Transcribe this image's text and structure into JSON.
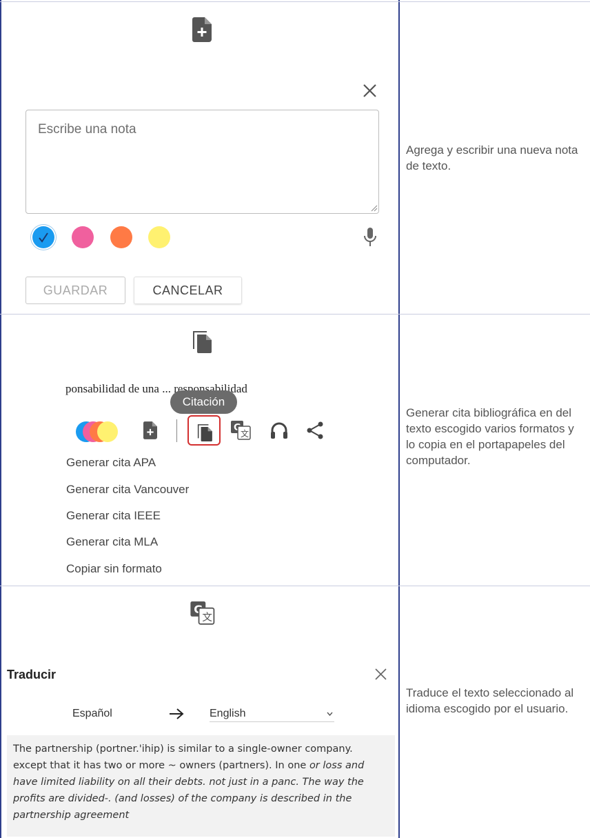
{
  "rows": [
    {
      "note_panel": {
        "placeholder": "Escribe una nota",
        "save_label": "GUARDAR",
        "cancel_label": "CANCELAR",
        "colors": [
          "#1a9bf0",
          "#f0609e",
          "#ff7a45",
          "#fff170"
        ],
        "selected_color_index": 0,
        "icons": [
          "add-note-icon",
          "close-icon",
          "microphone-icon"
        ]
      },
      "description": "Agrega y escribir una nueva nota de texto."
    },
    {
      "citation_panel": {
        "snippet": "ponsabilidad de una  ... responsabilidad",
        "tooltip": "Citación",
        "menu_items": [
          "Generar cita APA",
          "Generar cita Vancouver",
          "Generar cita IEEE",
          "Generar cita MLA",
          "Copiar sin formato"
        ],
        "toolbar_icons": [
          "color-picker-icon",
          "add-note-icon",
          "citation-icon",
          "translate-icon",
          "headphones-icon",
          "share-icon"
        ],
        "highlight_color": "#d32f2f"
      },
      "description": "Generar cita bibliográfica en del texto escogido varios formatos y lo copia en el portapapeles del computador."
    },
    {
      "translate_panel": {
        "title": "Traducir",
        "source_language": "Español",
        "target_language": "English",
        "text_plain": "The partnership (portner.'ihip) is similar to a single-owner company. except that it has two or more ~ owners (partners). In one",
        "text_italic": "or loss and have limited liability on all their debts. not just in a panc. The way the profits are divided-. (and losses) of the company is described in the partnership agreement",
        "icons": [
          "translate-icon",
          "close-icon",
          "arrow-right-icon",
          "chevron-down-icon"
        ]
      },
      "description": "Traduce el texto seleccionado al idioma escogido por el usuario."
    }
  ]
}
